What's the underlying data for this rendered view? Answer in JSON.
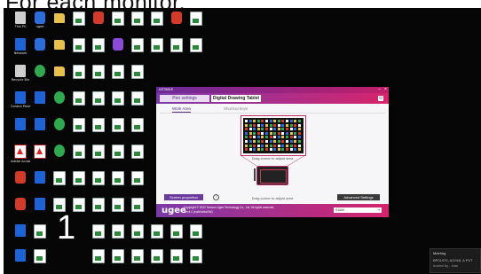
{
  "page": {
    "heading": "For each monitor."
  },
  "desktop": {
    "overlay_number": "1",
    "columns": [
      [
        {
          "label": "This PC",
          "kind": "gray"
        },
        {
          "label": "Network",
          "kind": "blue"
        },
        {
          "label": "Recycle Bin",
          "kind": "gray"
        },
        {
          "label": "Control Panel",
          "kind": "blue"
        },
        {
          "label": "",
          "kind": "blue"
        },
        {
          "label": "Adobe Acrobat",
          "kind": "pdf"
        },
        {
          "label": "",
          "kind": "red"
        },
        {
          "label": "",
          "kind": "red"
        },
        {
          "label": "",
          "kind": "blue"
        },
        {
          "label": "",
          "kind": "blue"
        }
      ],
      [
        {
          "label": "ugee",
          "kind": "app"
        },
        {
          "label": "",
          "kind": "app"
        },
        {
          "label": "",
          "kind": "green"
        },
        {
          "label": "",
          "kind": "blue"
        },
        {
          "label": "",
          "kind": "blue"
        },
        {
          "label": "",
          "kind": "pdf"
        },
        {
          "label": "",
          "kind": "blue"
        },
        {
          "label": "",
          "kind": "blue"
        },
        {
          "label": "",
          "kind": "doc"
        },
        {
          "label": "",
          "kind": "doc"
        }
      ],
      [
        {
          "label": "",
          "kind": "folder"
        },
        {
          "label": "",
          "kind": "folder"
        },
        {
          "label": "",
          "kind": "folder"
        },
        {
          "label": "",
          "kind": "green"
        },
        {
          "label": "",
          "kind": "green"
        },
        {
          "label": "",
          "kind": "green"
        },
        {
          "label": "",
          "kind": "doc"
        },
        {
          "label": "",
          "kind": "doc"
        },
        {
          "label": "",
          "kind": "doc"
        },
        {
          "label": "",
          "kind": "doc"
        }
      ],
      [
        {
          "label": "",
          "kind": "doc"
        },
        {
          "label": "",
          "kind": "doc"
        },
        {
          "label": "",
          "kind": "doc"
        },
        {
          "label": "",
          "kind": "doc"
        },
        {
          "label": "",
          "kind": "doc"
        },
        {
          "label": "",
          "kind": "doc"
        },
        {
          "label": "",
          "kind": "doc"
        },
        {
          "label": "",
          "kind": "doc"
        },
        {
          "label": "",
          "kind": "doc"
        },
        {
          "label": "",
          "kind": "doc"
        }
      ],
      [
        {
          "label": "",
          "kind": "red"
        },
        {
          "label": "",
          "kind": "doc"
        },
        {
          "label": "",
          "kind": "doc"
        },
        {
          "label": "",
          "kind": "doc"
        },
        {
          "label": "",
          "kind": "doc"
        },
        {
          "label": "",
          "kind": "doc"
        },
        {
          "label": "",
          "kind": "doc"
        },
        {
          "label": "",
          "kind": "doc"
        },
        {
          "label": "",
          "kind": "doc"
        },
        {
          "label": "",
          "kind": "doc"
        }
      ],
      [
        {
          "label": "",
          "kind": "doc"
        },
        {
          "label": "",
          "kind": "purple"
        },
        {
          "label": "",
          "kind": "doc"
        },
        {
          "label": "",
          "kind": "doc"
        },
        {
          "label": "",
          "kind": "doc"
        },
        {
          "label": "",
          "kind": "doc"
        },
        {
          "label": "",
          "kind": "doc"
        },
        {
          "label": "",
          "kind": "doc"
        },
        {
          "label": "",
          "kind": "doc"
        },
        {
          "label": "",
          "kind": "doc"
        }
      ],
      [
        {
          "label": "",
          "kind": "doc"
        },
        {
          "label": "",
          "kind": "doc"
        },
        {
          "label": "",
          "kind": "doc"
        },
        {
          "label": "",
          "kind": "doc"
        },
        {
          "label": "",
          "kind": "doc"
        },
        {
          "label": "",
          "kind": "doc"
        },
        {
          "label": "",
          "kind": "doc"
        },
        {
          "label": "",
          "kind": "doc"
        },
        {
          "label": "",
          "kind": "doc"
        },
        {
          "label": "",
          "kind": "doc"
        }
      ],
      [
        {
          "label": "",
          "kind": "doc"
        },
        {
          "label": "",
          "kind": "doc"
        },
        {
          "label": "",
          "kind": "doc"
        },
        {
          "label": "",
          "kind": "doc"
        },
        {
          "label": "",
          "kind": "doc"
        },
        {
          "label": "",
          "kind": "doc"
        },
        {
          "label": "",
          "kind": "doc"
        },
        {
          "label": "",
          "kind": "doc"
        },
        {
          "label": "",
          "kind": "doc"
        },
        {
          "label": "",
          "kind": "doc"
        }
      ],
      [
        {
          "label": "",
          "kind": "red"
        },
        {
          "label": "",
          "kind": "doc"
        },
        {
          "label": "",
          "kind": "doc"
        },
        {
          "label": "",
          "kind": "doc"
        },
        {
          "label": "",
          "kind": "doc"
        },
        {
          "label": "",
          "kind": "doc"
        },
        {
          "label": "",
          "kind": "doc"
        },
        {
          "label": "",
          "kind": "doc"
        },
        {
          "label": "",
          "kind": "doc"
        },
        {
          "label": "",
          "kind": "doc"
        }
      ],
      [
        {
          "label": "",
          "kind": "doc"
        },
        {
          "label": "",
          "kind": "doc"
        },
        {
          "label": "",
          "kind": "doc"
        },
        {
          "label": "",
          "kind": "doc"
        },
        {
          "label": "",
          "kind": "doc"
        },
        {
          "label": "",
          "kind": "doc"
        },
        {
          "label": "",
          "kind": "doc"
        },
        {
          "label": "",
          "kind": "doc"
        },
        {
          "label": "",
          "kind": "doc"
        },
        {
          "label": "",
          "kind": "doc"
        }
      ]
    ]
  },
  "notification": {
    "title": "Meeting",
    "line1": "BP01970, A/1918, A PVT",
    "line2": "Invited by - Ivan"
  },
  "ugee_window": {
    "title": "UGTABLE",
    "tabs": {
      "pen_settings": "Pen settings",
      "digital_drawing_tablet": "Digital Drawing Tablet"
    },
    "subtabs": {
      "work_area": "Work Area",
      "shortcut_keys": "Shortcut keys"
    },
    "caption_screen": "Drag corner to adjust area",
    "caption_tablet": "Drag corner to adjust area",
    "screen_proportion": "Screen proportion",
    "info_symbol": "?",
    "advanced_settings": "Advanced Settings",
    "logo": "ugee",
    "copyright": "Copyright © 2022 Hanvon Ugee Technology Co., Ltd. All rights reserved.",
    "version": "Ver:4.0 (build beta/2W)",
    "device": "S1060"
  },
  "colors": {
    "accent_purple": "#6b3b9e",
    "accent_pink": "#d6246d",
    "desktop_bg": "#060606"
  }
}
